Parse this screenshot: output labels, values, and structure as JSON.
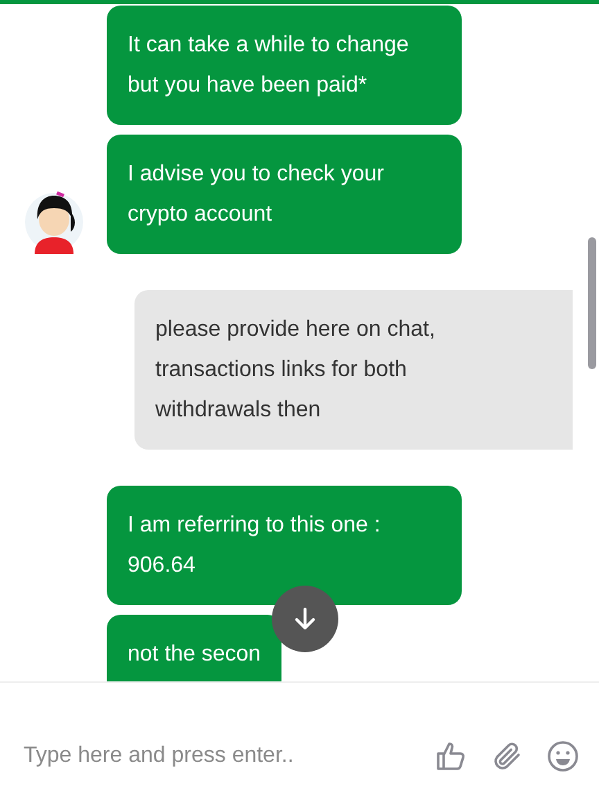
{
  "messages": [
    {
      "kind": "agent",
      "text": "It can take a while to change but you have been paid*",
      "avatar": false
    },
    {
      "kind": "agent",
      "text": "I advise you to check your crypto account",
      "avatar": true
    },
    {
      "kind": "visitor",
      "text": "please provide here on chat, transactions links for both withdrawals then"
    },
    {
      "kind": "agent",
      "text": "I am referring to this one : 906.64",
      "avatar": false
    },
    {
      "kind": "agent",
      "text": "not the secon",
      "avatar": false
    }
  ],
  "composer": {
    "placeholder": "Type here and press enter.."
  }
}
